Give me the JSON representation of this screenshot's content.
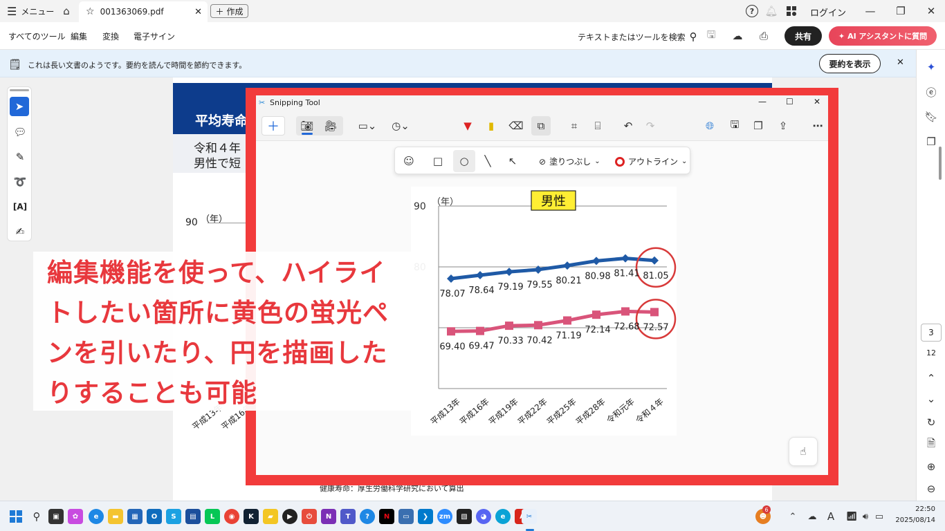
{
  "titlebar": {
    "menu_label": "メニュー",
    "tab_title": "001363069.pdf",
    "create_label": "作成",
    "login_label": "ログイン"
  },
  "toolbar": {
    "items": [
      "すべてのツール",
      "編集",
      "変換",
      "電子サイン"
    ],
    "search_label": "テキストまたはツールを検索",
    "share_label": "共有",
    "ai_label": "AI アシスタントに質問"
  },
  "infobar": {
    "message": "これは長い文書のようです。要約を読んで時間を節約できます。",
    "summary_button": "要約を表示"
  },
  "page": {
    "header_text": "平均寿命",
    "sub_line1": "令和４年",
    "sub_line2": "男性で短",
    "bg_y_tick": "90",
    "bg_y_unit": "（年）",
    "bg_x_labels": [
      "平成13年",
      "平成16年"
    ],
    "footer_text": "健康寿命：厚生労働科学研究において算出"
  },
  "overlay": {
    "lines": [
      "編集機能を使って、ハイライ",
      "トしたい箇所に黄色の蛍光ペ",
      "ンを引いたり、円を描画した",
      "りすることも可能"
    ]
  },
  "snipping": {
    "title": "Snipping Tool",
    "fill_label": "塗りつぶし",
    "outline_label": "アウトライン"
  },
  "chart_data": {
    "type": "line",
    "title": "男性",
    "ylabel": "（年）",
    "y_ticks_visible": [
      "90",
      "80"
    ],
    "categories": [
      "平成13年",
      "平成16年",
      "平成19年",
      "平成22年",
      "平成25年",
      "平成28年",
      "令和元年",
      "令和４年"
    ],
    "series": [
      {
        "values": [
          78.07,
          78.64,
          79.19,
          79.55,
          80.21,
          80.98,
          81.41,
          81.05
        ],
        "labels": [
          "78.07",
          "78.64",
          "79.19",
          "79.55",
          "80.21",
          "80.98",
          "81.41",
          "81.05"
        ],
        "color": "#1f5aa6",
        "marker": "diamond"
      },
      {
        "values": [
          69.4,
          69.47,
          70.33,
          70.42,
          71.19,
          72.14,
          72.68,
          72.57
        ],
        "labels": [
          "69.40",
          "69.47",
          "70.33",
          "70.42",
          "71.19",
          "72.14",
          "72.68",
          "72.57"
        ],
        "color": "#d9547a",
        "marker": "square"
      }
    ],
    "ylim": [
      60,
      90
    ],
    "grid": true,
    "title_bg": "#ffee33",
    "annotation_color": "#d83a3a"
  },
  "right_rail": {
    "page_current": "3",
    "page_total": "12"
  },
  "taskbar": {
    "time": "22:50",
    "date": "2025/08/14",
    "badge": "6"
  }
}
